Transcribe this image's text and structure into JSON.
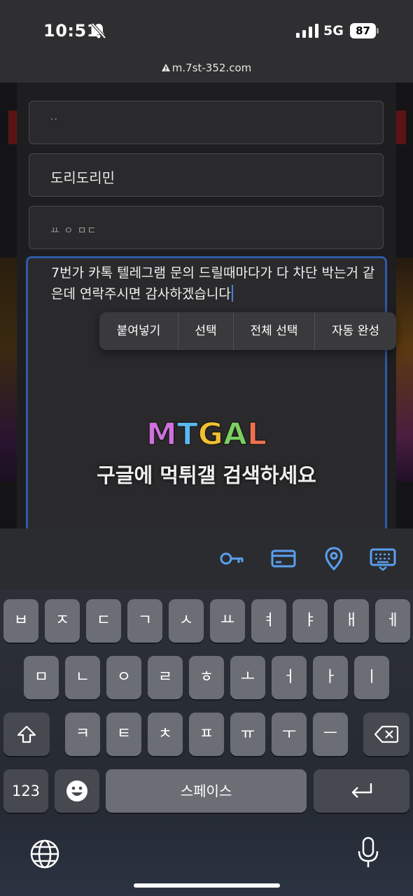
{
  "status_bar": {
    "time": "10:51",
    "network": "5G",
    "battery": "87",
    "url": "m.7st-352.com"
  },
  "form": {
    "field1_value": "··",
    "field2_value": "도리도리민",
    "field3_value": "ㅛ ㅇ   ㅁㄷ",
    "textarea_value": "7번가 카톡 텔레그램 문의 드릴때마다가 다 차단 박는거 같은데 연락주시면 감사하겠습니다"
  },
  "context_menu": [
    "붙여넣기",
    "선택",
    "전체 선택",
    "자동 완성"
  ],
  "watermark": {
    "logo_letters": [
      "M",
      "T",
      "G",
      "A",
      "L"
    ],
    "tagline": "구글에 먹튀갤 검색하세요"
  },
  "autofill_icons": [
    "key-icon",
    "credit-card-icon",
    "location-pin-icon",
    "keyboard-icon"
  ],
  "keyboard": {
    "row1": [
      "ㅂ",
      "ㅈ",
      "ㄷ",
      "ㄱ",
      "ㅅ",
      "ㅛ",
      "ㅕ",
      "ㅑ",
      "ㅐ",
      "ㅔ"
    ],
    "row2": [
      "ㅁ",
      "ㄴ",
      "ㅇ",
      "ㄹ",
      "ㅎ",
      "ㅗ",
      "ㅓ",
      "ㅏ",
      "ㅣ"
    ],
    "row3": [
      "ㅋ",
      "ㅌ",
      "ㅊ",
      "ㅍ",
      "ㅠ",
      "ㅜ",
      "ㅡ"
    ],
    "numbers_label": "123",
    "space_label": "스페이스"
  },
  "colors": {
    "accent_blue": "#2e5aa8",
    "autofill_icon": "#5aa0f0"
  }
}
